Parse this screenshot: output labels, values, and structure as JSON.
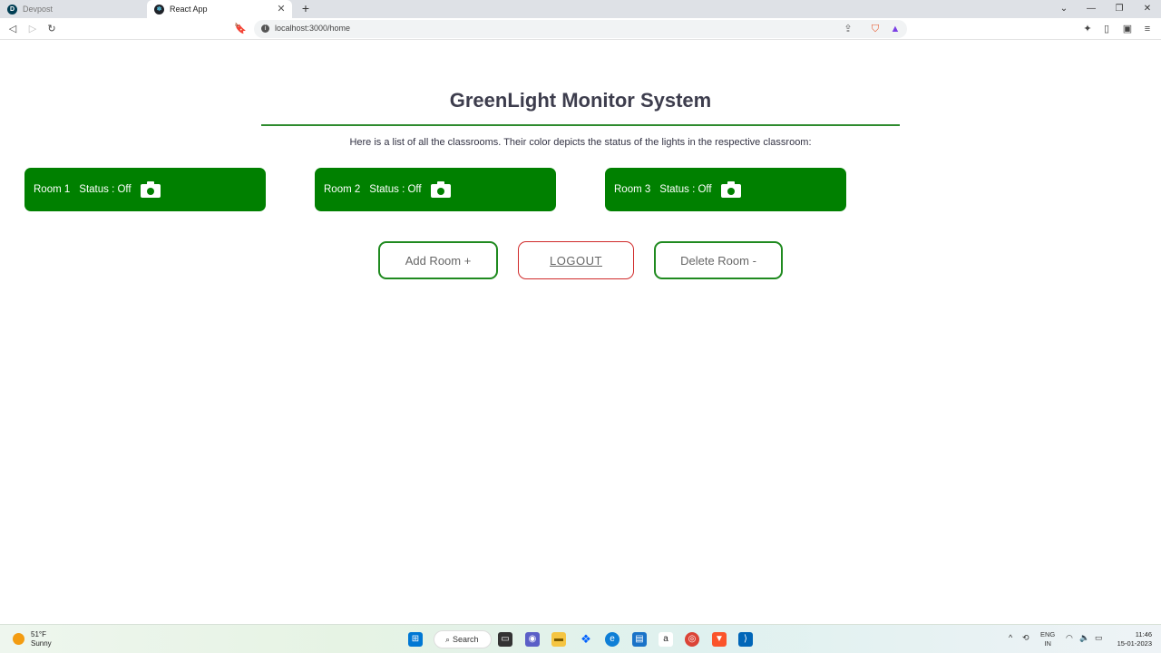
{
  "browser": {
    "tabs": [
      {
        "title": "Devpost",
        "favicon": "D"
      },
      {
        "title": "React App",
        "favicon": "⚛"
      }
    ],
    "url": "localhost:3000/home",
    "window_controls": {
      "minimize": "—",
      "restore": "❐",
      "close": "✕",
      "tab_list": "⌄"
    }
  },
  "page": {
    "title": "GreenLight Monitor System",
    "intro": "Here is a list of all the classrooms. Their color depicts the status of the lights in the respective classroom:",
    "rooms": [
      {
        "name": "Room 1",
        "status": "Status : Off"
      },
      {
        "name": "Room 2",
        "status": "Status : Off"
      },
      {
        "name": "Room 3",
        "status": "Status : Off"
      }
    ],
    "buttons": {
      "add_room": "Add Room +",
      "logout": "LOGOUT",
      "delete_room": "Delete Room -"
    },
    "colors": {
      "room_card": "#008000",
      "accent_green": "#1f8a1f",
      "logout_red": "#d02a2a"
    }
  },
  "taskbar": {
    "weather": {
      "temp": "51°F",
      "condition": "Sunny"
    },
    "search_label": "Search",
    "language": {
      "line1": "ENG",
      "line2": "IN"
    },
    "clock": {
      "time": "11:46",
      "date": "15-01-2023"
    }
  }
}
